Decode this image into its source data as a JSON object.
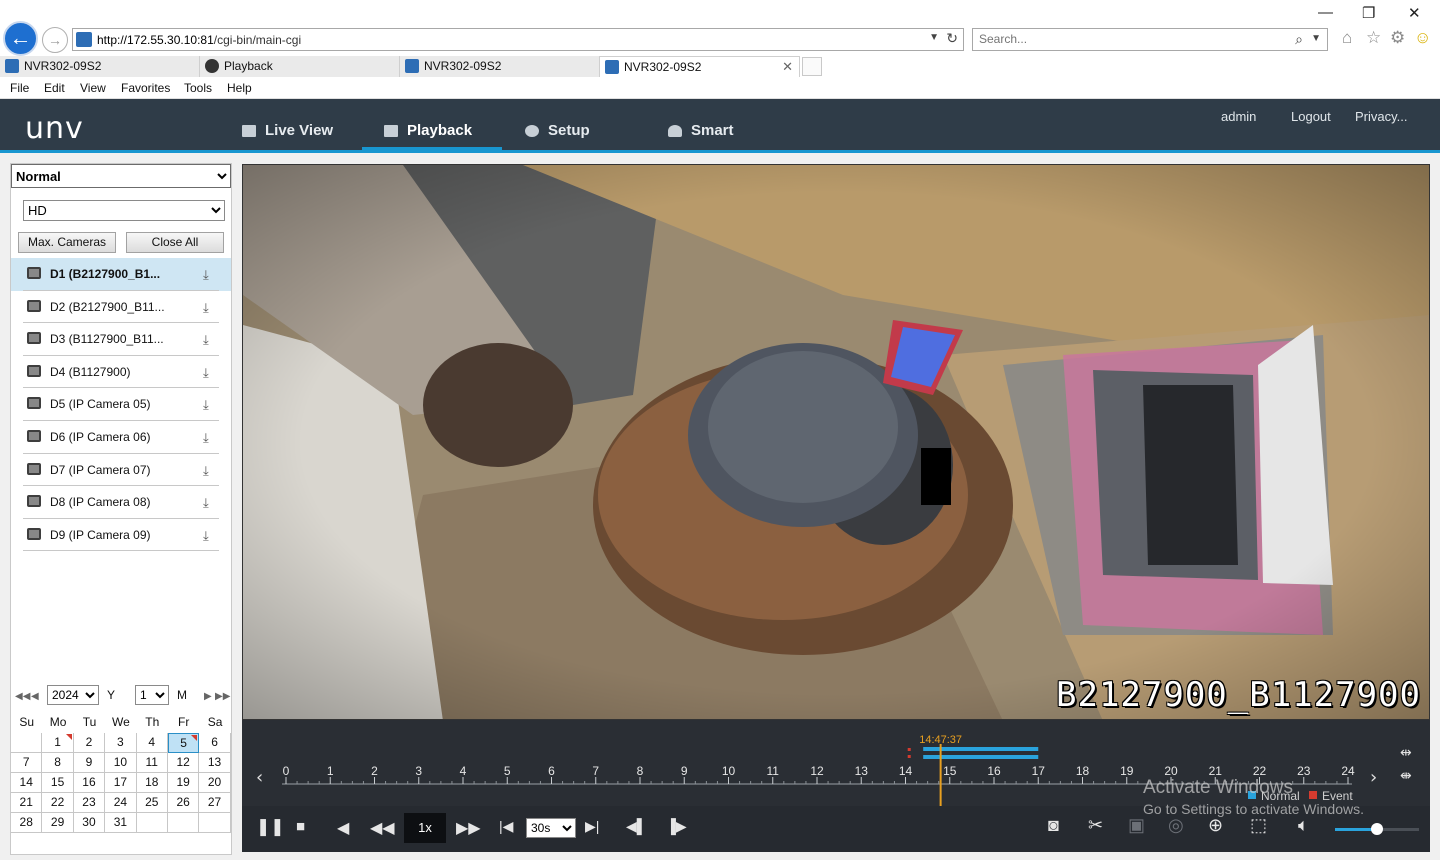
{
  "browser": {
    "url_prefix": "http://172.55.30.10:81",
    "url_path": "/cgi-bin/main-cgi",
    "search_placeholder": "Search...",
    "tabs": [
      {
        "label": "NVR302-09S2"
      },
      {
        "label": "Playback"
      },
      {
        "label": "NVR302-09S2"
      },
      {
        "label": "NVR302-09S2"
      }
    ],
    "menu": [
      "File",
      "Edit",
      "View",
      "Favorites",
      "Tools",
      "Help"
    ]
  },
  "app": {
    "logo": "unv",
    "nav": [
      {
        "label": "Live View",
        "icon": "monitor-icon"
      },
      {
        "label": "Playback",
        "icon": "playback-icon"
      },
      {
        "label": "Setup",
        "icon": "gear-icon"
      },
      {
        "label": "Smart",
        "icon": "smart-icon"
      }
    ],
    "user": "admin",
    "logout": "Logout",
    "privacy": "Privacy..."
  },
  "sidebar": {
    "mode": "Normal",
    "stream": "HD",
    "max_cameras": "Max. Cameras",
    "close_all": "Close All",
    "cameras": [
      {
        "label": "D1 (B2127900_B1...",
        "selected": true
      },
      {
        "label": "D2 (B2127900_B11...",
        "selected": false
      },
      {
        "label": "D3 (B1127900_B11...",
        "selected": false
      },
      {
        "label": "D4 (B1127900)",
        "selected": false
      },
      {
        "label": "D5 (IP Camera 05)",
        "selected": false
      },
      {
        "label": "D6 (IP Camera 06)",
        "selected": false
      },
      {
        "label": "D7 (IP Camera 07)",
        "selected": false
      },
      {
        "label": "D8 (IP Camera 08)",
        "selected": false
      },
      {
        "label": "D9 (IP Camera 09)",
        "selected": false
      }
    ]
  },
  "calendar": {
    "year": "2024",
    "year_label": "Y",
    "month": "1",
    "month_label": "M",
    "weekdays": [
      "Su",
      "Mo",
      "Tu",
      "We",
      "Th",
      "Fr",
      "Sa"
    ],
    "weeks": [
      [
        "",
        "1",
        "2",
        "3",
        "4",
        "5",
        "6"
      ],
      [
        "7",
        "8",
        "9",
        "10",
        "11",
        "12",
        "13"
      ],
      [
        "14",
        "15",
        "16",
        "17",
        "18",
        "19",
        "20"
      ],
      [
        "21",
        "22",
        "23",
        "24",
        "25",
        "26",
        "27"
      ],
      [
        "28",
        "29",
        "30",
        "31",
        "",
        "",
        ""
      ]
    ],
    "recorded_days": [
      "1",
      "5"
    ],
    "selected_day": "5"
  },
  "video": {
    "osd_text": "B2127900_B1127900"
  },
  "timeline": {
    "current_time": "14:47:37",
    "hours": [
      "0",
      "1",
      "2",
      "3",
      "4",
      "5",
      "6",
      "7",
      "8",
      "9",
      "10",
      "11",
      "12",
      "13",
      "14",
      "15",
      "16",
      "17",
      "18",
      "19",
      "20",
      "21",
      "22",
      "23",
      "24"
    ],
    "legend_normal": "Normal",
    "legend_event": "Event",
    "colors": {
      "normal": "#2aa3dc",
      "event": "#d43b2f",
      "cursor": "#e8a020"
    }
  },
  "controls": {
    "speed": "1x",
    "step": "30s",
    "volume": 0.5
  },
  "watermark": {
    "line1": "Activate Windows",
    "line2": "Go to Settings to activate Windows."
  }
}
